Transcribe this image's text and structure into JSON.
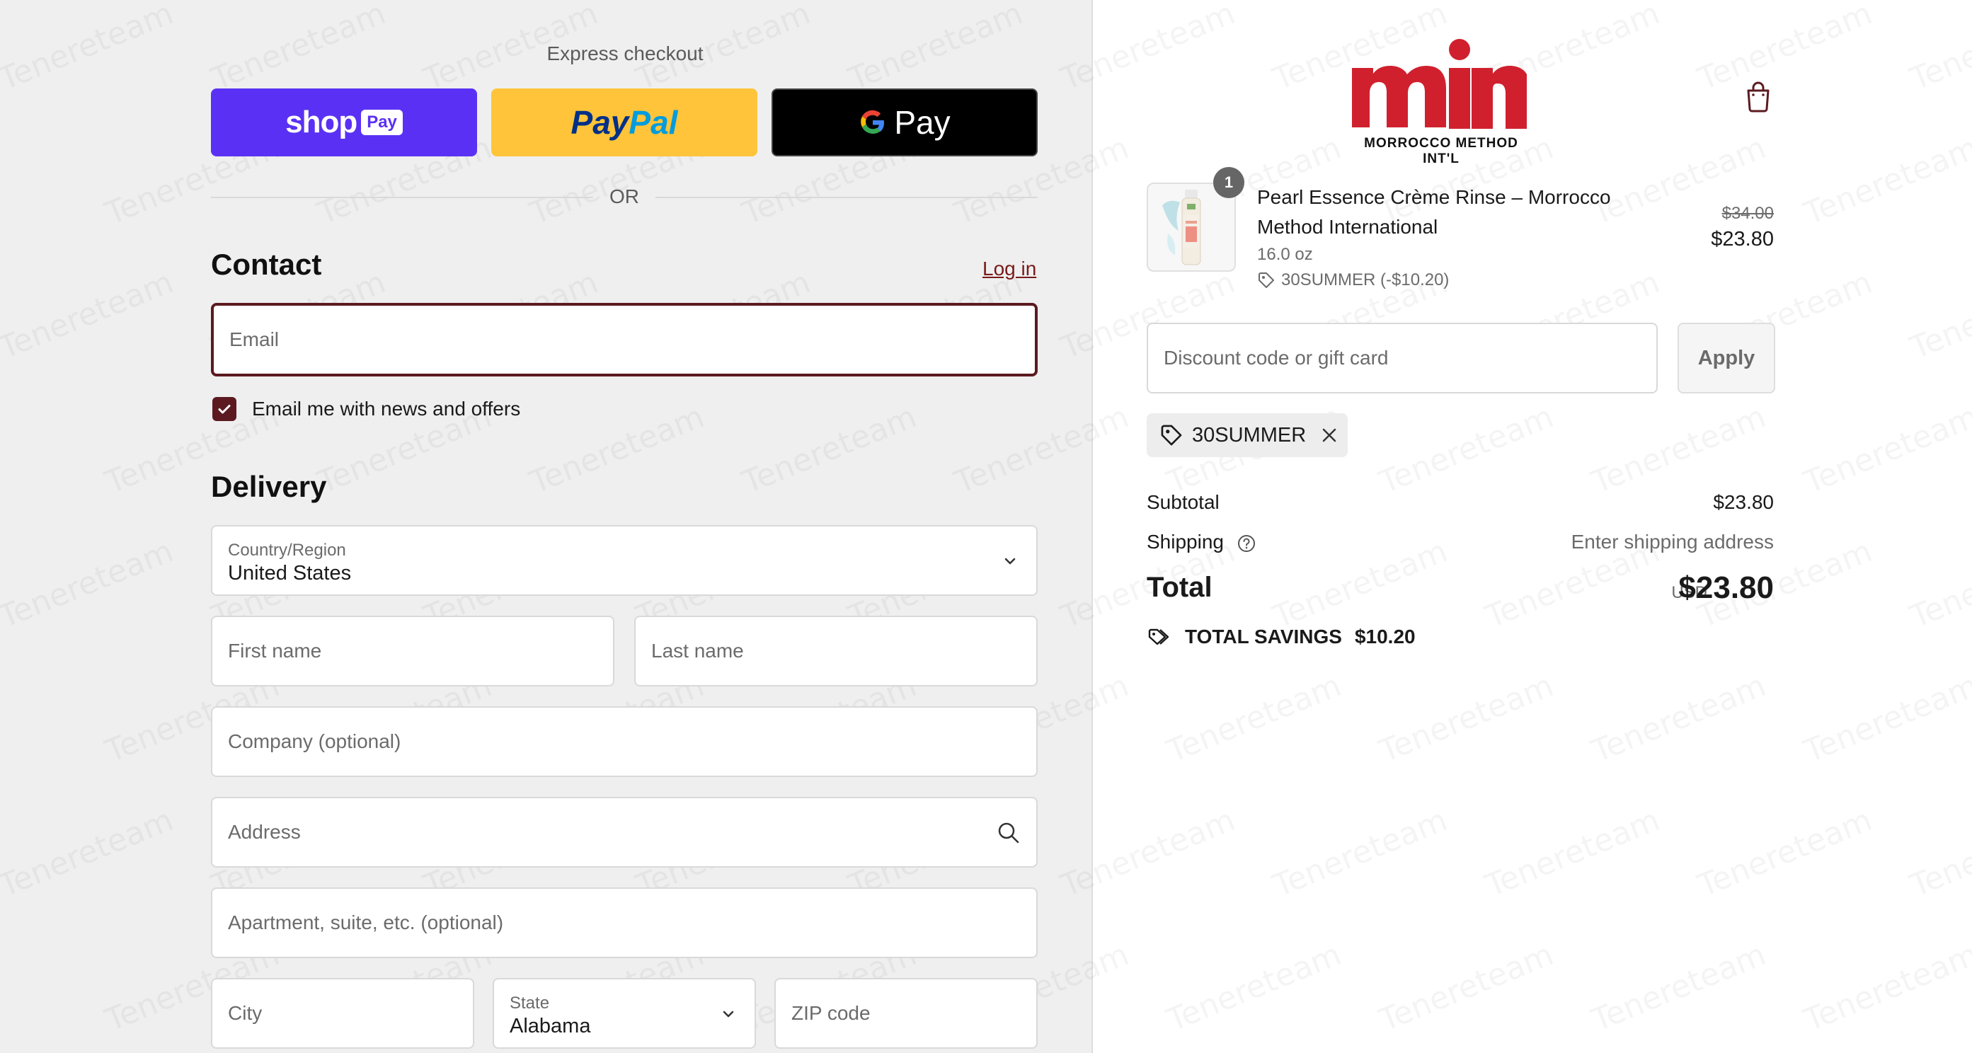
{
  "express": {
    "title": "Express checkout",
    "shop_pay": {
      "word": "shop",
      "badge": "Pay"
    },
    "paypal": {
      "part1": "Pay",
      "part2": "Pal"
    },
    "gpay": {
      "g": "G",
      "text": "Pay"
    },
    "or_text": "OR"
  },
  "contact": {
    "title": "Contact",
    "login_label": "Log in",
    "email_placeholder": "Email",
    "newsletter_label": "Email me with news and offers",
    "newsletter_checked": true
  },
  "delivery": {
    "title": "Delivery",
    "country_label": "Country/Region",
    "country_value": "United States",
    "first_name_placeholder": "First name",
    "last_name_placeholder": "Last name",
    "company_placeholder": "Company (optional)",
    "address_placeholder": "Address",
    "apartment_placeholder": "Apartment, suite, etc. (optional)",
    "city_placeholder": "City",
    "state_label": "State",
    "state_value": "Alabama",
    "zip_placeholder": "ZIP code"
  },
  "brand": {
    "logo_letters": "mim",
    "logo_subtitle": "MORROCCO METHOD INT'L",
    "logo_color": "#d0202e"
  },
  "order": {
    "item": {
      "quantity": "1",
      "name": "Pearl Essence Crème Rinse – Morrocco Method International",
      "size": "16.0 oz",
      "discount": "30SUMMER (-$10.20)",
      "old_price": "$34.00",
      "price": "$23.80"
    },
    "discount_placeholder": "Discount code or gift card",
    "apply_label": "Apply",
    "applied_code": "30SUMMER",
    "subtotal_label": "Subtotal",
    "subtotal_value": "$23.80",
    "shipping_label": "Shipping",
    "shipping_value": "Enter shipping address",
    "total_label": "Total",
    "total_currency": "USD",
    "total_value": "$23.80",
    "savings_label": "TOTAL SAVINGS",
    "savings_value": "$10.20"
  },
  "colors": {
    "shop_pay": "#5a31f4",
    "paypal": "#ffc439",
    "accent": "#5c1a20"
  },
  "watermark": "Tenereteam"
}
